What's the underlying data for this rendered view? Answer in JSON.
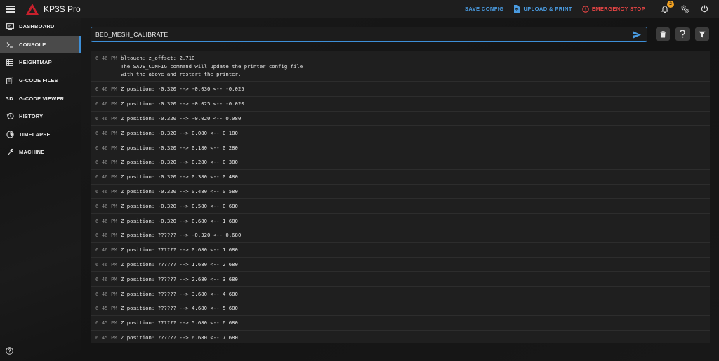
{
  "app": {
    "title": "KP3S Pro",
    "notification_count": "2"
  },
  "toolbar": {
    "save_config": "SAVE CONFIG",
    "upload_print": "UPLOAD & PRINT",
    "emergency_stop": "EMERGENCY STOP"
  },
  "sidebar": {
    "items": [
      {
        "label": "DASHBOARD",
        "icon": "monitor-icon"
      },
      {
        "label": "CONSOLE",
        "icon": "console-icon"
      },
      {
        "label": "HEIGHTMAP",
        "icon": "grid-icon"
      },
      {
        "label": "G-CODE FILES",
        "icon": "files-icon"
      },
      {
        "label": "G-CODE VIEWER",
        "icon": "3d-icon"
      },
      {
        "label": "HISTORY",
        "icon": "history-icon"
      },
      {
        "label": "TIMELAPSE",
        "icon": "timelapse-icon"
      },
      {
        "label": "MACHINE",
        "icon": "wrench-icon"
      }
    ]
  },
  "command": {
    "value": "BED_MESH_CALIBRATE"
  },
  "console": {
    "entries": [
      {
        "time": "6:46 PM",
        "lines": [
          "bltouch: z_offset: 2.710",
          "The SAVE_CONFIG command will update the printer config file",
          "with the above and restart the printer."
        ]
      },
      {
        "time": "6:46 PM",
        "text": "Z position: -0.320 --> -0.030 <-- -0.025"
      },
      {
        "time": "6:46 PM",
        "text": "Z position: -0.320 --> -0.025 <-- -0.020"
      },
      {
        "time": "6:46 PM",
        "text": "Z position: -0.320 --> -0.020 <-- 0.080"
      },
      {
        "time": "6:46 PM",
        "text": "Z position: -0.320 --> 0.080 <-- 0.180"
      },
      {
        "time": "6:46 PM",
        "text": "Z position: -0.320 --> 0.180 <-- 0.280"
      },
      {
        "time": "6:46 PM",
        "text": "Z position: -0.320 --> 0.280 <-- 0.380"
      },
      {
        "time": "6:46 PM",
        "text": "Z position: -0.320 --> 0.380 <-- 0.480"
      },
      {
        "time": "6:46 PM",
        "text": "Z position: -0.320 --> 0.480 <-- 0.580"
      },
      {
        "time": "6:46 PM",
        "text": "Z position: -0.320 --> 0.580 <-- 0.680"
      },
      {
        "time": "6:46 PM",
        "text": "Z position: -0.320 --> 0.680 <-- 1.680"
      },
      {
        "time": "6:46 PM",
        "text": "Z position: ?????? --> -0.320 <-- 0.680"
      },
      {
        "time": "6:46 PM",
        "text": "Z position: ?????? --> 0.680 <-- 1.680"
      },
      {
        "time": "6:46 PM",
        "text": "Z position: ?????? --> 1.680 <-- 2.680"
      },
      {
        "time": "6:46 PM",
        "text": "Z position: ?????? --> 2.680 <-- 3.680"
      },
      {
        "time": "6:46 PM",
        "text": "Z position: ?????? --> 3.680 <-- 4.680"
      },
      {
        "time": "6:45 PM",
        "text": "Z position: ?????? --> 4.680 <-- 5.680"
      },
      {
        "time": "6:45 PM",
        "text": "Z position: ?????? --> 5.680 <-- 6.680"
      },
      {
        "time": "6:45 PM",
        "text": "Z position: ?????? --> 6.680 <-- 7.680"
      }
    ]
  },
  "colors": {
    "accent": "#3d8fd8",
    "danger": "#e84545",
    "badge": "#f0a020",
    "logo": "#c8202c"
  }
}
